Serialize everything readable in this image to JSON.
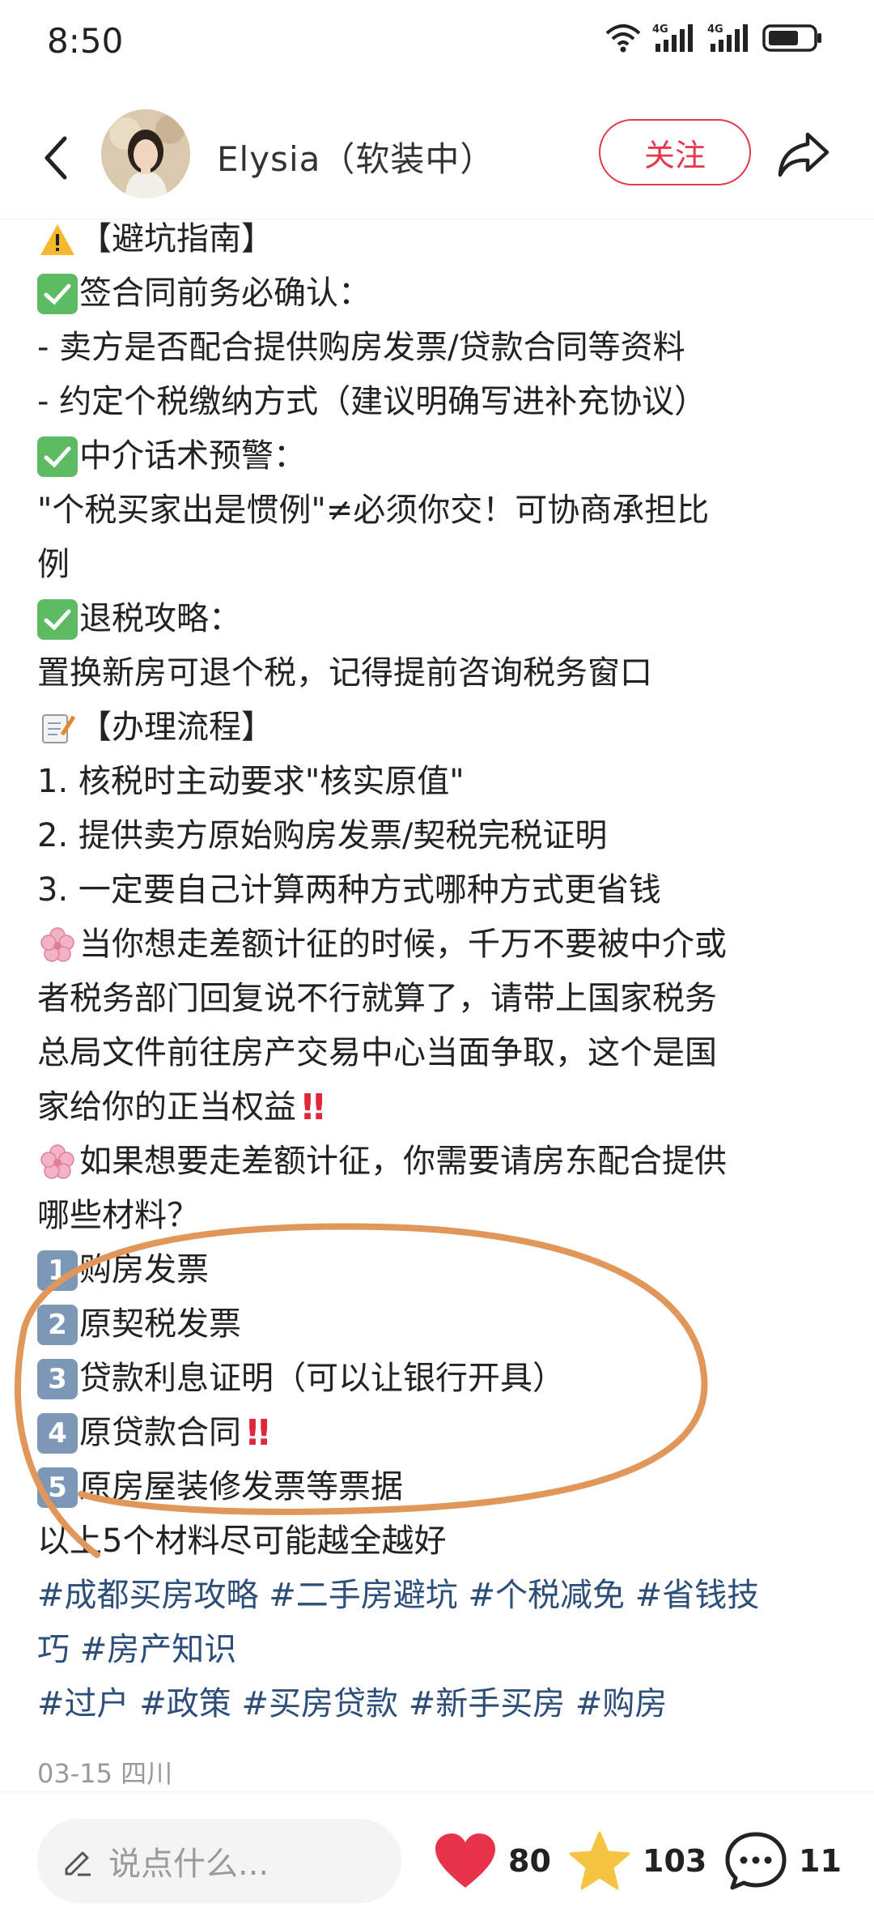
{
  "status_bar": {
    "time": "8:50",
    "icons": [
      "wifi-icon",
      "signal-4g-icon",
      "signal-4g-icon",
      "battery-icon"
    ],
    "signal_labels": [
      "4G",
      "4G"
    ]
  },
  "header": {
    "author_name": "Elysia（软装中）",
    "follow_label": "关注"
  },
  "content": {
    "lines": [
      "【避坑指南】",
      "签合同前务必确认：",
      "- 卖方是否配合提供购房发票/贷款合同等资料",
      "- 约定个税缴纳方式（建议明确写进补充协议）",
      "中介话术预警：",
      "\"个税买家出是惯例\"≠必须你交！可协商承担比",
      "例",
      "退税攻略：",
      "置换新房可退个税，记得提前咨询税务窗口",
      "【办理流程】",
      "1. 核税时主动要求\"核实原值\"",
      "2. 提供卖方原始购房发票/契税完税证明",
      "3. 一定要自己计算两种方式哪种方式更省钱",
      "当你想走差额计征的时候，千万不要被中介或",
      "者税务部门回复说不行就算了，请带上国家税务",
      "总局文件前往房产交易中心当面争取，这个是国",
      "家给你的正当权益",
      "如果想要走差额计征，你需要请房东配合提供",
      "哪些材料？",
      "购房发票",
      "原契税发票",
      "贷款利息证明（可以让银行开具）",
      "原贷款合同",
      "原房屋装修发票等票据",
      "以上5个材料尽可能越全越好"
    ],
    "numbers": [
      "1",
      "2",
      "3",
      "4",
      "5"
    ],
    "tags_line1": "#成都买房攻略 #二手房避坑 #个税减免 #省钱技",
    "tags_line2": "巧 #房产知识",
    "tags_line3": "#过户 #政策 #买房贷款 #新手买房 #购房"
  },
  "meta": {
    "date_location": "03-15 四川"
  },
  "bottom_bar": {
    "comment_placeholder": "说点什么...",
    "likes": "80",
    "favorites": "103",
    "comments": "11"
  },
  "colors": {
    "accent_red": "#e4394b",
    "tag_blue": "#2c4e78",
    "annotation_orange": "#e2975a"
  }
}
